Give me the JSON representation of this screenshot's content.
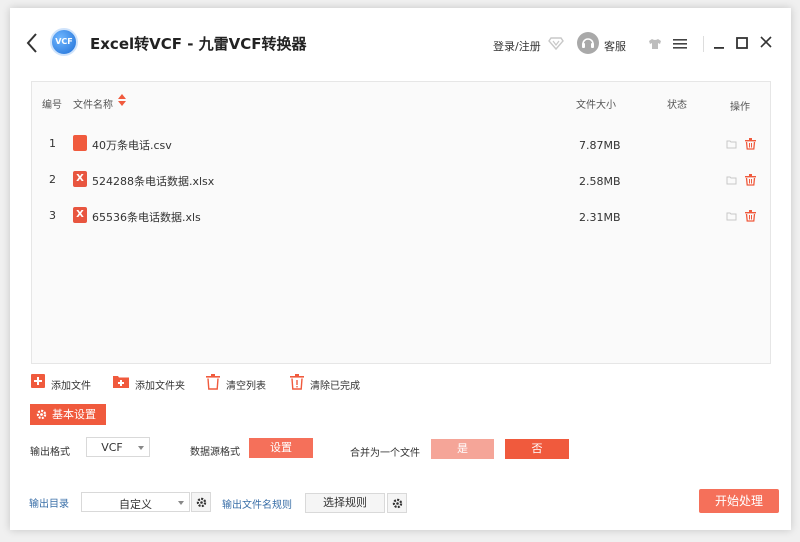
{
  "header": {
    "title": "Excel转VCF - 九雷VCF转换器",
    "logo_text": "VCF",
    "login_label": "登录/注册",
    "service_label": "客服"
  },
  "table": {
    "columns": {
      "index": "编号",
      "name": "文件名称",
      "size": "文件大小",
      "status": "状态",
      "action": "操作"
    },
    "rows": [
      {
        "index": "1",
        "name": "40万条电话.csv",
        "size": "7.87MB",
        "status": "",
        "icon": "csv-file-icon"
      },
      {
        "index": "2",
        "name": "524288条电话数据.xlsx",
        "size": "2.58MB",
        "status": "",
        "icon": "excel-file-icon"
      },
      {
        "index": "3",
        "name": "65536条电话数据.xls",
        "size": "2.31MB",
        "status": "",
        "icon": "excel-file-icon"
      }
    ]
  },
  "toolbar": {
    "add_file": "添加文件",
    "add_folder": "添加文件夹",
    "clear_list": "清空列表",
    "clear_done": "清除已完成"
  },
  "settings": {
    "section_label": "基本设置",
    "output_format_label": "输出格式",
    "output_format_value": "VCF",
    "source_format_label": "数据源格式",
    "source_format_button": "设置",
    "merge_label": "合并为一个文件",
    "merge_yes": "是",
    "merge_no": "否",
    "merge_selected": "否"
  },
  "footer": {
    "output_dir_label": "输出目录",
    "output_dir_value": "自定义",
    "filename_rule_label": "输出文件名规则",
    "filename_rule_button": "选择规则",
    "start_button": "开始处理"
  },
  "colors": {
    "accent": "#f05a3d",
    "accent_light": "#f5a598",
    "link_blue": "#3a6fa8",
    "start": "#f5705a"
  }
}
